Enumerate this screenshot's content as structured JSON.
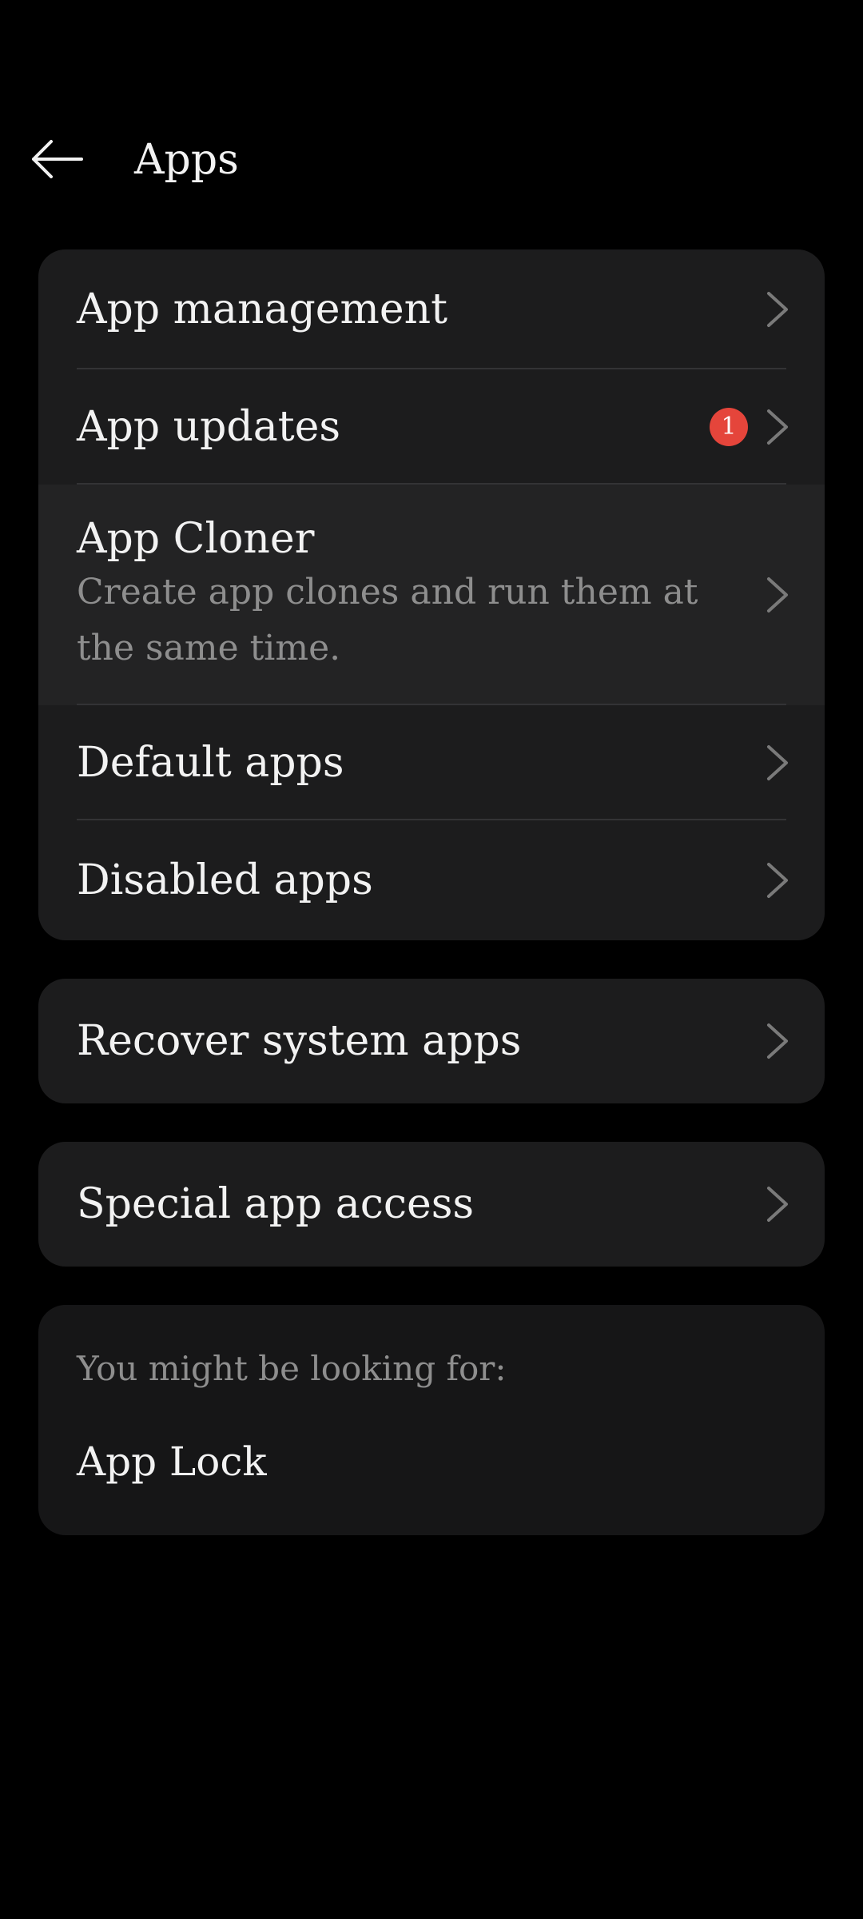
{
  "header": {
    "back_icon": "back-arrow-icon",
    "title": "Apps"
  },
  "main_card": {
    "items": [
      {
        "label": "App management",
        "icon": "chevron-right-icon"
      },
      {
        "label": "App updates",
        "badge": "1",
        "badge_color": "#e5453b",
        "icon": "chevron-right-icon"
      },
      {
        "label": "App Cloner",
        "subtitle": "Create app clones and run them at the same time.",
        "icon": "chevron-right-icon"
      },
      {
        "label": "Default apps",
        "icon": "chevron-right-icon"
      },
      {
        "label": "Disabled apps",
        "icon": "chevron-right-icon"
      }
    ]
  },
  "recover_card": {
    "label": "Recover system apps"
  },
  "special_card": {
    "label": "Special app access"
  },
  "suggestions": {
    "title": "You might be looking for:",
    "link": "App Lock"
  },
  "colors": {
    "background": "#000000",
    "card": "#1c1c1d",
    "text_primary": "#f2f2f2",
    "text_secondary": "#8e8e8e",
    "badge": "#e5453b"
  }
}
